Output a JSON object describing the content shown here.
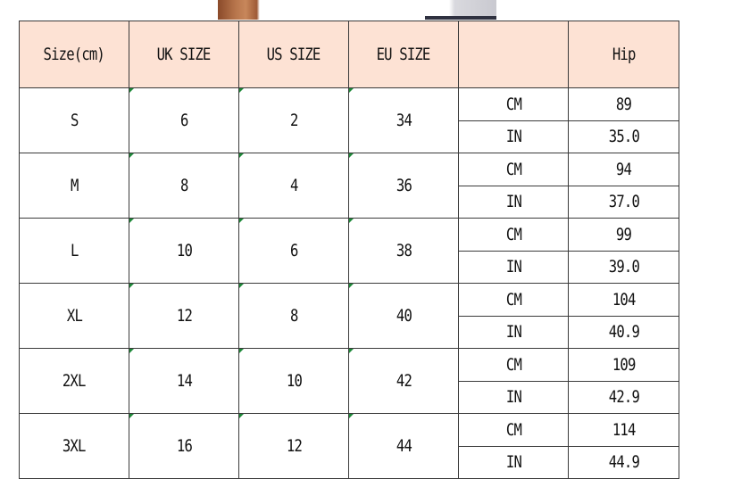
{
  "table": {
    "headers": [
      "Size(cm)",
      "UK SIZE",
      "US SIZE",
      "EU SIZE",
      "",
      "Hip"
    ],
    "rows": [
      {
        "size": "S",
        "uk": "6",
        "us": "2",
        "eu": "34",
        "cm_label": "CM",
        "cm": "89",
        "in_label": "IN",
        "in": "35.0"
      },
      {
        "size": "M",
        "uk": "8",
        "us": "4",
        "eu": "36",
        "cm_label": "CM",
        "cm": "94",
        "in_label": "IN",
        "in": "37.0"
      },
      {
        "size": "L",
        "uk": "10",
        "us": "6",
        "eu": "38",
        "cm_label": "CM",
        "cm": "99",
        "in_label": "IN",
        "in": "39.0"
      },
      {
        "size": "XL",
        "uk": "12",
        "us": "8",
        "eu": "40",
        "cm_label": "CM",
        "cm": "104",
        "in_label": "IN",
        "in": "40.9"
      },
      {
        "size": "2XL",
        "uk": "14",
        "us": "10",
        "eu": "42",
        "cm_label": "CM",
        "cm": "109",
        "in_label": "IN",
        "in": "42.9"
      },
      {
        "size": "3XL",
        "uk": "16",
        "us": "12",
        "eu": "44",
        "cm_label": "CM",
        "cm": "114",
        "in_label": "IN",
        "in": "44.9"
      }
    ]
  },
  "colors": {
    "header_bg": "#fde2d4",
    "border": "#3a3a3a",
    "corner_mark": "#1f8a3a"
  }
}
